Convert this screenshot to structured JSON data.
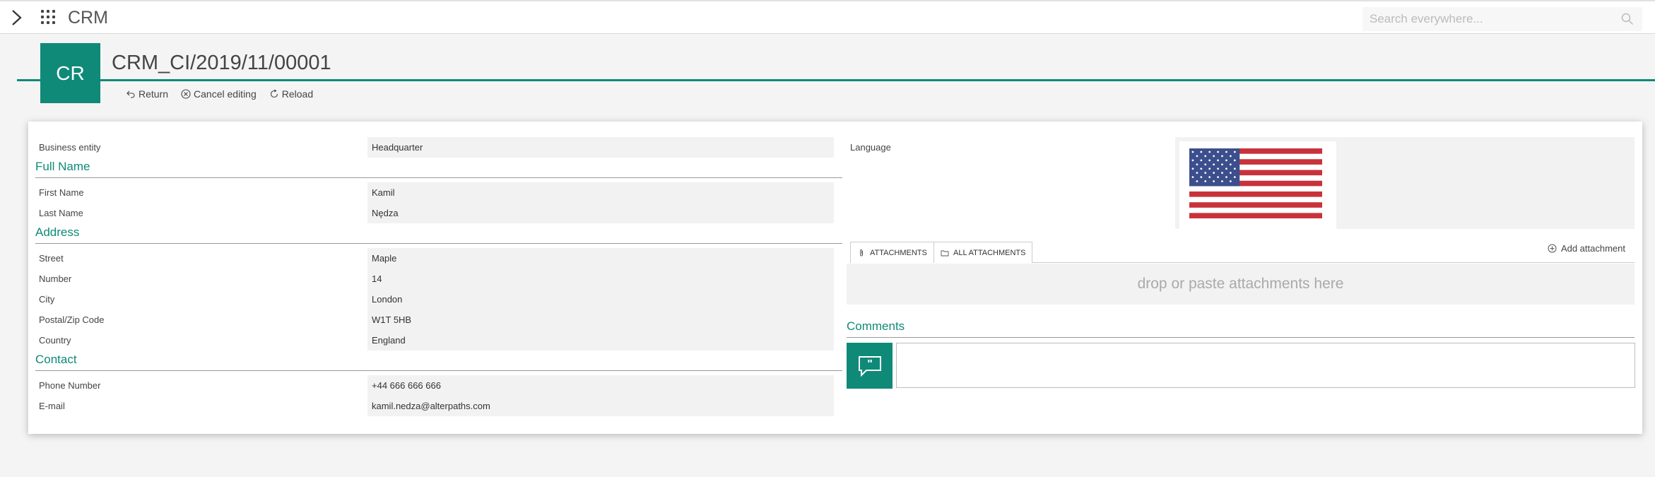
{
  "app": {
    "title": "CRM",
    "search_placeholder": "Search everywhere..."
  },
  "record": {
    "tile_initials": "CR",
    "title": "CRM_CI/2019/11/00001",
    "actions": {
      "return": "Return",
      "cancel": "Cancel editing",
      "reload": "Reload"
    }
  },
  "form": {
    "business_entity": {
      "label": "Business entity",
      "value": "Headquarter"
    },
    "sections": {
      "full_name": "Full Name",
      "address": "Address",
      "contact": "Contact"
    },
    "fields": {
      "first_name": {
        "label": "First Name",
        "value": "Kamil"
      },
      "last_name": {
        "label": "Last Name",
        "value": "Nędza"
      },
      "street": {
        "label": "Street",
        "value": "Maple"
      },
      "number": {
        "label": "Number",
        "value": "14"
      },
      "city": {
        "label": "City",
        "value": "London"
      },
      "postal": {
        "label": "Postal/Zip Code",
        "value": "W1T 5HB"
      },
      "country": {
        "label": "Country",
        "value": "England"
      },
      "phone": {
        "label": "Phone Number",
        "value": "+44 666 666 666"
      },
      "email": {
        "label": "E-mail",
        "value": "kamil.nedza@alterpaths.com"
      }
    },
    "language": {
      "label": "Language",
      "value_icon": "us-flag-icon"
    }
  },
  "attachments": {
    "tab_attachments": "ATTACHMENTS",
    "tab_all": "ALL ATTACHMENTS",
    "add": "Add attachment",
    "drop_text": "drop or paste attachments here"
  },
  "comments": {
    "title": "Comments",
    "input_value": ""
  },
  "colors": {
    "accent": "#0f8a78",
    "field_bg": "#f2f2f2"
  }
}
